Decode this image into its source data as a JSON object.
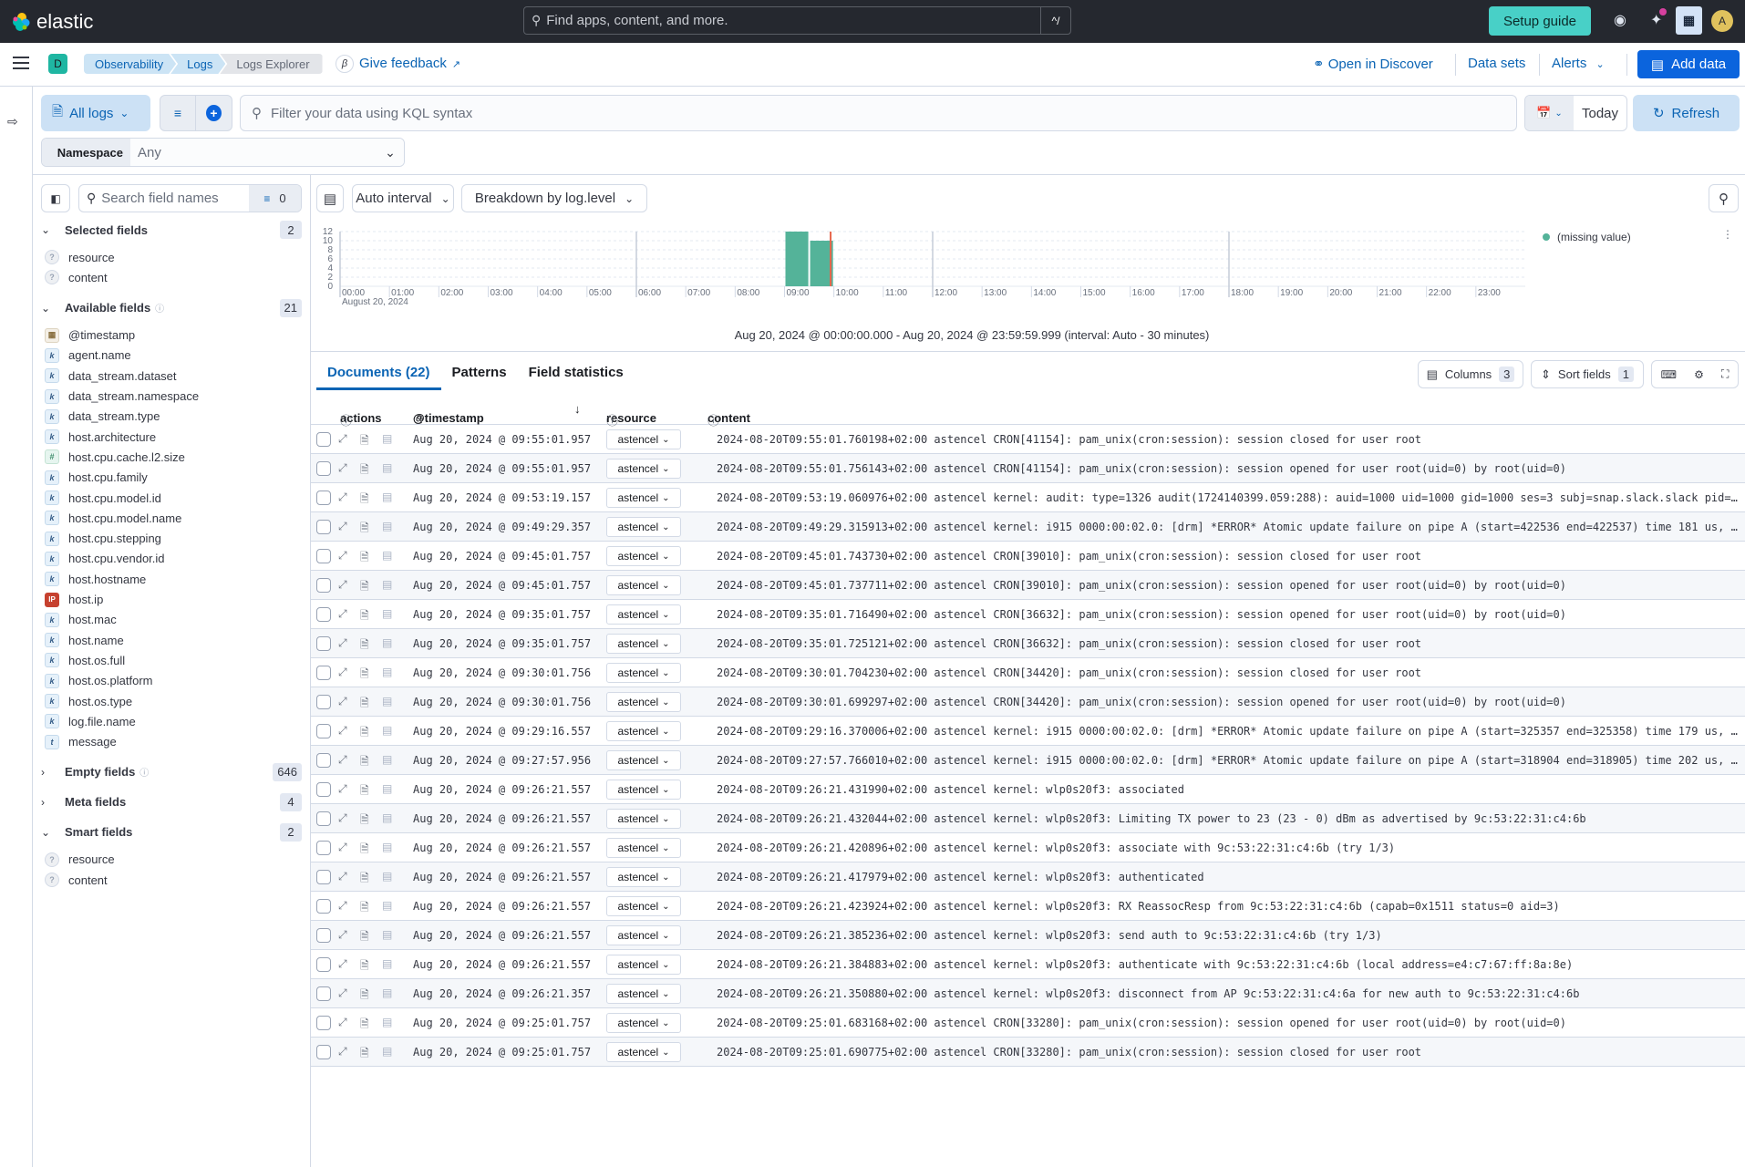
{
  "app": {
    "brand": "elastic",
    "global_search_placeholder": "Find apps, content, and more.",
    "global_search_shortcut": "^/",
    "setup_guide_label": "Setup guide",
    "avatar_initial": "A",
    "space_initial": "D"
  },
  "breadcrumbs": [
    "Observability",
    "Logs",
    "Logs Explorer"
  ],
  "nav": {
    "beta_badge": "β",
    "feedback_label": "Give feedback",
    "open_in_discover_label": "Open in Discover",
    "data_sets_label": "Data sets",
    "alerts_label": "Alerts",
    "add_data_label": "Add data"
  },
  "query_bar": {
    "data_view_label": "All logs",
    "kql_placeholder": "Filter your data using KQL syntax",
    "date_label": "Today",
    "refresh_label": "Refresh",
    "namespace_label": "Namespace",
    "namespace_value": "Any"
  },
  "sidebar": {
    "search_placeholder": "Search field names",
    "filter_count": "0",
    "sections": [
      {
        "title": "Selected fields",
        "count": "2",
        "expanded": true,
        "help": false,
        "fields": [
          {
            "name": "resource",
            "type": "unknown"
          },
          {
            "name": "content",
            "type": "unknown"
          }
        ]
      },
      {
        "title": "Available fields",
        "count": "21",
        "expanded": true,
        "help": true,
        "fields": [
          {
            "name": "@timestamp",
            "type": "date"
          },
          {
            "name": "agent.name",
            "type": "keyword"
          },
          {
            "name": "data_stream.dataset",
            "type": "keyword"
          },
          {
            "name": "data_stream.namespace",
            "type": "keyword"
          },
          {
            "name": "data_stream.type",
            "type": "keyword"
          },
          {
            "name": "host.architecture",
            "type": "keyword"
          },
          {
            "name": "host.cpu.cache.l2.size",
            "type": "number"
          },
          {
            "name": "host.cpu.family",
            "type": "keyword"
          },
          {
            "name": "host.cpu.model.id",
            "type": "keyword"
          },
          {
            "name": "host.cpu.model.name",
            "type": "keyword"
          },
          {
            "name": "host.cpu.stepping",
            "type": "keyword"
          },
          {
            "name": "host.cpu.vendor.id",
            "type": "keyword"
          },
          {
            "name": "host.hostname",
            "type": "keyword"
          },
          {
            "name": "host.ip",
            "type": "ip"
          },
          {
            "name": "host.mac",
            "type": "keyword"
          },
          {
            "name": "host.name",
            "type": "keyword"
          },
          {
            "name": "host.os.full",
            "type": "keyword"
          },
          {
            "name": "host.os.platform",
            "type": "keyword"
          },
          {
            "name": "host.os.type",
            "type": "keyword"
          },
          {
            "name": "log.file.name",
            "type": "keyword"
          },
          {
            "name": "message",
            "type": "text"
          }
        ]
      },
      {
        "title": "Empty fields",
        "count": "646",
        "expanded": false,
        "help": true,
        "fields": []
      },
      {
        "title": "Meta fields",
        "count": "4",
        "expanded": false,
        "help": false,
        "fields": []
      },
      {
        "title": "Smart fields",
        "count": "2",
        "expanded": true,
        "help": false,
        "fields": [
          {
            "name": "resource",
            "type": "unknown"
          },
          {
            "name": "content",
            "type": "unknown"
          }
        ]
      }
    ]
  },
  "histogram_toolbar": {
    "interval_label": "Auto interval",
    "breakdown_label": "Breakdown by log.level"
  },
  "chart_data": {
    "type": "bar",
    "title": "",
    "xlabel": "",
    "ylabel": "",
    "x_ticks": [
      "00:00",
      "01:00",
      "02:00",
      "03:00",
      "04:00",
      "05:00",
      "06:00",
      "07:00",
      "08:00",
      "09:00",
      "10:00",
      "11:00",
      "12:00",
      "13:00",
      "14:00",
      "15:00",
      "16:00",
      "17:00",
      "18:00",
      "19:00",
      "20:00",
      "21:00",
      "22:00",
      "23:00"
    ],
    "x_date_label": "August 20, 2024",
    "y_ticks": [
      0,
      2,
      4,
      6,
      8,
      10,
      12
    ],
    "ylim": [
      0,
      12
    ],
    "xlim_hours": [
      0,
      24
    ],
    "interval_minutes": 30,
    "grid": true,
    "series": [
      {
        "name": "(missing value)",
        "color": "#54b399",
        "points": [
          {
            "start": "09:00",
            "value": 12
          },
          {
            "start": "09:30",
            "value": 10
          }
        ]
      }
    ],
    "current_time_marker": "09:56",
    "legend_position": "right",
    "range_label": "Aug 20, 2024 @ 00:00:00.000 - Aug 20, 2024 @ 23:59:59.999 (interval: Auto - 30 minutes)"
  },
  "tabs": [
    {
      "label": "Documents (22)",
      "active": true
    },
    {
      "label": "Patterns",
      "active": false
    },
    {
      "label": "Field statistics",
      "active": false
    }
  ],
  "table_toolbar": {
    "columns_label": "Columns",
    "columns_count": "3",
    "sort_label": "Sort fields",
    "sort_count": "1"
  },
  "table": {
    "headers": {
      "actions": "actions",
      "timestamp": "@timestamp",
      "resource": "resource",
      "content": "content"
    },
    "rows": [
      {
        "timestamp": "Aug 20, 2024 @ 09:55:01.957",
        "resource": "astencel",
        "content": "2024-08-20T09:55:01.760198+02:00 astencel CRON[41154]: pam_unix(cron:session): session closed for user root"
      },
      {
        "timestamp": "Aug 20, 2024 @ 09:55:01.957",
        "resource": "astencel",
        "content": "2024-08-20T09:55:01.756143+02:00 astencel CRON[41154]: pam_unix(cron:session): session opened for user root(uid=0) by root(uid=0)"
      },
      {
        "timestamp": "Aug 20, 2024 @ 09:53:19.157",
        "resource": "astencel",
        "content": "2024-08-20T09:53:19.060976+02:00 astencel kernel: audit: type=1326 audit(1724140399.059:288): auid=1000 uid=1000 gid=1000 ses=3 subj=snap.slack.slack pid=…"
      },
      {
        "timestamp": "Aug 20, 2024 @ 09:49:29.357",
        "resource": "astencel",
        "content": "2024-08-20T09:49:29.315913+02:00 astencel kernel: i915 0000:00:02.0: [drm] *ERROR* Atomic update failure on pipe A (start=422536 end=422537) time 181 us, …"
      },
      {
        "timestamp": "Aug 20, 2024 @ 09:45:01.757",
        "resource": "astencel",
        "content": "2024-08-20T09:45:01.743730+02:00 astencel CRON[39010]: pam_unix(cron:session): session closed for user root"
      },
      {
        "timestamp": "Aug 20, 2024 @ 09:45:01.757",
        "resource": "astencel",
        "content": "2024-08-20T09:45:01.737711+02:00 astencel CRON[39010]: pam_unix(cron:session): session opened for user root(uid=0) by root(uid=0)"
      },
      {
        "timestamp": "Aug 20, 2024 @ 09:35:01.757",
        "resource": "astencel",
        "content": "2024-08-20T09:35:01.716490+02:00 astencel CRON[36632]: pam_unix(cron:session): session opened for user root(uid=0) by root(uid=0)"
      },
      {
        "timestamp": "Aug 20, 2024 @ 09:35:01.757",
        "resource": "astencel",
        "content": "2024-08-20T09:35:01.725121+02:00 astencel CRON[36632]: pam_unix(cron:session): session closed for user root"
      },
      {
        "timestamp": "Aug 20, 2024 @ 09:30:01.756",
        "resource": "astencel",
        "content": "2024-08-20T09:30:01.704230+02:00 astencel CRON[34420]: pam_unix(cron:session): session closed for user root"
      },
      {
        "timestamp": "Aug 20, 2024 @ 09:30:01.756",
        "resource": "astencel",
        "content": "2024-08-20T09:30:01.699297+02:00 astencel CRON[34420]: pam_unix(cron:session): session opened for user root(uid=0) by root(uid=0)"
      },
      {
        "timestamp": "Aug 20, 2024 @ 09:29:16.557",
        "resource": "astencel",
        "content": "2024-08-20T09:29:16.370006+02:00 astencel kernel: i915 0000:00:02.0: [drm] *ERROR* Atomic update failure on pipe A (start=325357 end=325358) time 179 us, …"
      },
      {
        "timestamp": "Aug 20, 2024 @ 09:27:57.956",
        "resource": "astencel",
        "content": "2024-08-20T09:27:57.766010+02:00 astencel kernel: i915 0000:00:02.0: [drm] *ERROR* Atomic update failure on pipe A (start=318904 end=318905) time 202 us, …"
      },
      {
        "timestamp": "Aug 20, 2024 @ 09:26:21.557",
        "resource": "astencel",
        "content": "2024-08-20T09:26:21.431990+02:00 astencel kernel: wlp0s20f3: associated"
      },
      {
        "timestamp": "Aug 20, 2024 @ 09:26:21.557",
        "resource": "astencel",
        "content": "2024-08-20T09:26:21.432044+02:00 astencel kernel: wlp0s20f3: Limiting TX power to 23 (23 - 0) dBm as advertised by 9c:53:22:31:c4:6b"
      },
      {
        "timestamp": "Aug 20, 2024 @ 09:26:21.557",
        "resource": "astencel",
        "content": "2024-08-20T09:26:21.420896+02:00 astencel kernel: wlp0s20f3: associate with 9c:53:22:31:c4:6b (try 1/3)"
      },
      {
        "timestamp": "Aug 20, 2024 @ 09:26:21.557",
        "resource": "astencel",
        "content": "2024-08-20T09:26:21.417979+02:00 astencel kernel: wlp0s20f3: authenticated"
      },
      {
        "timestamp": "Aug 20, 2024 @ 09:26:21.557",
        "resource": "astencel",
        "content": "2024-08-20T09:26:21.423924+02:00 astencel kernel: wlp0s20f3: RX ReassocResp from 9c:53:22:31:c4:6b (capab=0x1511 status=0 aid=3)"
      },
      {
        "timestamp": "Aug 20, 2024 @ 09:26:21.557",
        "resource": "astencel",
        "content": "2024-08-20T09:26:21.385236+02:00 astencel kernel: wlp0s20f3: send auth to 9c:53:22:31:c4:6b (try 1/3)"
      },
      {
        "timestamp": "Aug 20, 2024 @ 09:26:21.557",
        "resource": "astencel",
        "content": "2024-08-20T09:26:21.384883+02:00 astencel kernel: wlp0s20f3: authenticate with 9c:53:22:31:c4:6b (local address=e4:c7:67:ff:8a:8e)"
      },
      {
        "timestamp": "Aug 20, 2024 @ 09:26:21.357",
        "resource": "astencel",
        "content": "2024-08-20T09:26:21.350880+02:00 astencel kernel: wlp0s20f3: disconnect from AP 9c:53:22:31:c4:6a for new auth to 9c:53:22:31:c4:6b"
      },
      {
        "timestamp": "Aug 20, 2024 @ 09:25:01.757",
        "resource": "astencel",
        "content": "2024-08-20T09:25:01.683168+02:00 astencel CRON[33280]: pam_unix(cron:session): session opened for user root(uid=0) by root(uid=0)"
      },
      {
        "timestamp": "Aug 20, 2024 @ 09:25:01.757",
        "resource": "astencel",
        "content": "2024-08-20T09:25:01.690775+02:00 astencel CRON[33280]: pam_unix(cron:session): session closed for user root"
      }
    ]
  },
  "colors": {
    "topbar": "#25282f",
    "primary": "#0b64dd",
    "link": "#0b64b4",
    "setup_guide": "#48d0c7",
    "series": "#54b399",
    "now_marker": "#e7664c"
  }
}
